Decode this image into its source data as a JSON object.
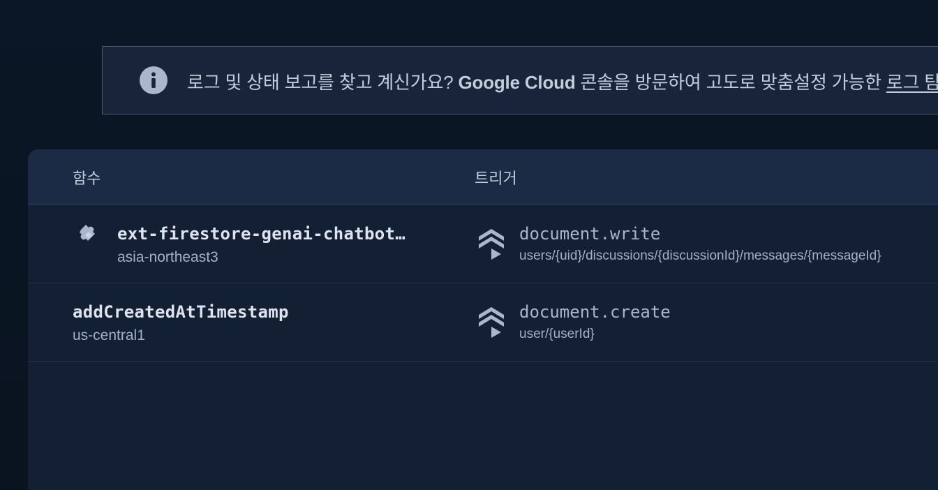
{
  "banner": {
    "icon": "info-icon",
    "text_before": "로그 및 상태 보고를 찾고 계신가요? ",
    "brand": "Google Cloud",
    "text_after": " 콘솔을 방문하여 고도로 맞춤설정 가능한 ",
    "link": "로그 탐"
  },
  "table": {
    "headers": {
      "function": "함수",
      "trigger": "트리거"
    },
    "rows": [
      {
        "icon": "extension-puzzle-icon",
        "name": "ext-firestore-genai-chatbot…",
        "region": "asia-northeast3",
        "trigger_icon": "firestore-icon",
        "event": "document.write",
        "path": "users/{uid}/discussions/{discussionId}/messages/{messageId}"
      },
      {
        "name": "addCreatedAtTimestamp",
        "region": "us-central1",
        "trigger_icon": "firestore-icon",
        "event": "document.create",
        "path": "user/{userId}"
      }
    ]
  },
  "colors": {
    "background": "#0b1626",
    "banner": "#18243a",
    "card": "#131f33",
    "header": "#1b2a45",
    "icon": "#a9b6cc"
  }
}
